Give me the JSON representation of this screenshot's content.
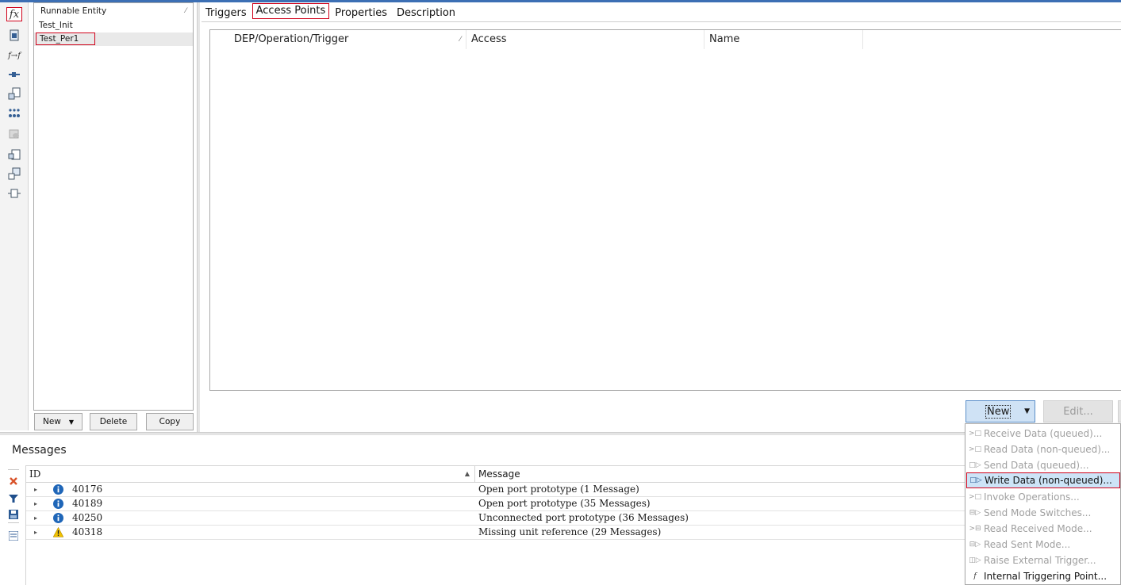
{
  "left_toolbar": {
    "icons": [
      "function-icon",
      "runnable-doc-icon",
      "function-sequence-icon",
      "port-icon",
      "table-add-icon",
      "dots-grid-icon",
      "database-icon",
      "component-icon",
      "component-list-icon",
      "mapping-icon"
    ],
    "function_glyph": "fx",
    "function_sequence_glyph": "f→f"
  },
  "runnable_panel": {
    "header": "Runnable Entity",
    "sort_glyph": "⁄",
    "items": [
      "Test_Init",
      "Test_Per1"
    ],
    "selected_index": 1,
    "buttons": {
      "new": "New",
      "delete": "Delete",
      "copy": "Copy"
    }
  },
  "tabs": [
    {
      "label": "Triggers",
      "active": false
    },
    {
      "label": "Access Points",
      "active": true
    },
    {
      "label": "Properties",
      "active": false
    },
    {
      "label": "Description",
      "active": false
    }
  ],
  "access_table": {
    "columns": [
      "DEP/Operation/Trigger",
      "Access",
      "Name"
    ],
    "sort_glyph": "⁄",
    "rows": []
  },
  "actions": {
    "new": "New",
    "edit": "Edit..."
  },
  "new_menu": {
    "items": [
      {
        "label": "Receive Data (queued)...",
        "enabled": false,
        "icon": "receive-icon"
      },
      {
        "label": "Read Data (non-queued)...",
        "enabled": false,
        "icon": "read-icon"
      },
      {
        "label": "Send Data (queued)...",
        "enabled": false,
        "icon": "send-icon"
      },
      {
        "label": "Write Data (non-queued)...",
        "enabled": true,
        "highlighted": true,
        "icon": "write-icon"
      },
      {
        "label": "Invoke Operations...",
        "enabled": false,
        "icon": "invoke-icon"
      },
      {
        "label": "Send Mode Switches...",
        "enabled": false,
        "icon": "mode-switch-icon"
      },
      {
        "label": "Read Received Mode...",
        "enabled": false,
        "icon": "received-mode-icon"
      },
      {
        "label": "Read Sent Mode...",
        "enabled": false,
        "icon": "sent-mode-icon"
      },
      {
        "label": "Raise External Trigger...",
        "enabled": false,
        "icon": "external-trigger-icon"
      },
      {
        "label": "Internal Triggering Point...",
        "enabled": true,
        "icon": "internal-trigger-icon"
      }
    ]
  },
  "messages": {
    "title": "Messages",
    "columns": {
      "id": "ID",
      "message": "Message"
    },
    "rows": [
      {
        "id": "40176",
        "severity": "info",
        "message": "Open port prototype (1 Message)"
      },
      {
        "id": "40189",
        "severity": "info",
        "message": "Open port prototype (35 Messages)"
      },
      {
        "id": "40250",
        "severity": "info",
        "message": "Unconnected port prototype (36 Messages)"
      },
      {
        "id": "40318",
        "severity": "warning",
        "message": "Missing unit reference (29 Messages)"
      }
    ],
    "tools": [
      "clear-icon",
      "filter-icon",
      "save-icon",
      "details-icon"
    ]
  },
  "colors": {
    "highlight_border": "#d0021b",
    "accent_blue": "#3c6fb4",
    "info_blue": "#1f66b8",
    "warning_yellow": "#f2c200"
  }
}
